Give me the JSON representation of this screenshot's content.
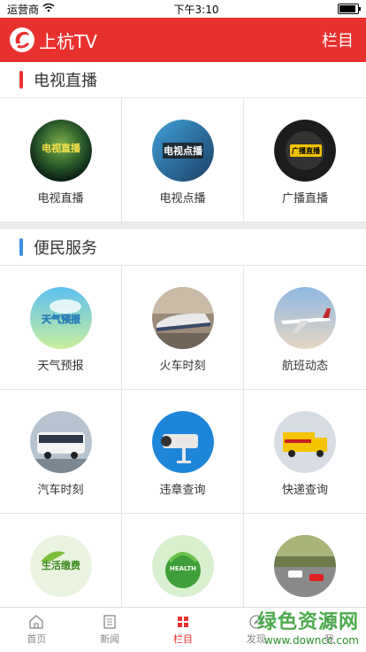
{
  "status": {
    "carrier": "运营商",
    "time": "下午3:10"
  },
  "header": {
    "brand": "上杭TV",
    "menu": "栏目"
  },
  "sections": [
    {
      "title": "电视直播",
      "color": "#e8312f",
      "items": [
        {
          "label": "电视直播",
          "icon": "tv-live-icon",
          "overlay": "电视直播"
        },
        {
          "label": "电视点播",
          "icon": "tv-vod-icon",
          "overlay": "电视点播"
        },
        {
          "label": "广播直播",
          "icon": "radio-live-icon",
          "overlay": "广播直播"
        }
      ]
    },
    {
      "title": "便民服务",
      "color": "#3b8fe0",
      "items": [
        {
          "label": "天气预报",
          "icon": "weather-icon",
          "overlay": "天气预报"
        },
        {
          "label": "火车时刻",
          "icon": "train-icon"
        },
        {
          "label": "航班动态",
          "icon": "airplane-icon"
        },
        {
          "label": "汽车时刻",
          "icon": "bus-icon"
        },
        {
          "label": "违章查询",
          "icon": "camera-icon"
        },
        {
          "label": "快递查询",
          "icon": "delivery-truck-icon"
        },
        {
          "label": "",
          "icon": "bill-payment-icon",
          "overlay": "生活缴费"
        },
        {
          "label": "",
          "icon": "health-icon",
          "overlay": "HEALTH"
        },
        {
          "label": "",
          "icon": "parking-icon"
        }
      ]
    }
  ],
  "tabs": [
    {
      "label": "首页",
      "icon": "home-icon"
    },
    {
      "label": "新闻",
      "icon": "news-icon"
    },
    {
      "label": "栏目",
      "icon": "grid-icon",
      "active": true
    },
    {
      "label": "发现",
      "icon": "discover-icon"
    },
    {
      "label": "我",
      "icon": "profile-icon"
    }
  ],
  "watermark": {
    "title": "绿色资源网",
    "url": "www.downcc.com"
  },
  "colors": {
    "accent": "#e8312f",
    "blue_bar": "#3b8fe0"
  }
}
